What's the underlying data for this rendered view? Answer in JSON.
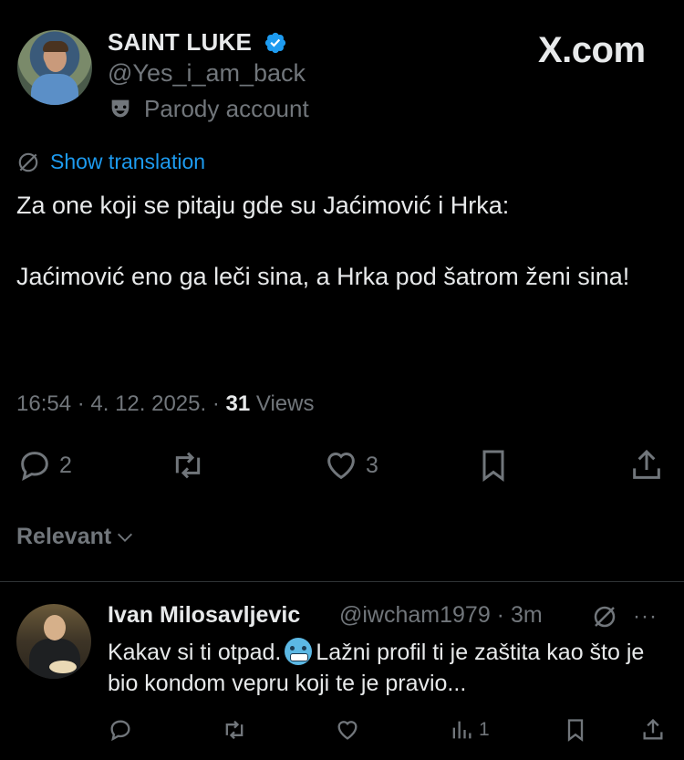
{
  "author": {
    "name": "SAINT LUKE",
    "handle": "@Yes_i_am_back",
    "label": "Parody account"
  },
  "brand": "X.com",
  "translation_link": "Show translation",
  "tweet": {
    "text": "Za one koji se pitaju gde su Jaćimović i Hrka:\n\nJaćimović eno ga leči sina, a Hrka pod šatrom ženi sina!",
    "time": "16:54 · 4. 12. 2025. · ",
    "views_count": "31",
    "views_label": "Views"
  },
  "actions": {
    "replies": "2",
    "likes": "3"
  },
  "sort_label": "Relevant",
  "reply": {
    "name": "Ivan Milosavljevic",
    "handle_time": "@iwcham1979 · 3m",
    "more": "···",
    "text_before": "Kakav si ti otpad.",
    "text_after": "Lažni profil ti je zaštita kao što je bio kondom vepru koji te je pravio...",
    "views": "1"
  },
  "colors": {
    "background": "#000000",
    "text": "#e7e9ea",
    "secondary": "#71767b",
    "link": "#1d9bf0",
    "verified": "#1d9bf0"
  }
}
